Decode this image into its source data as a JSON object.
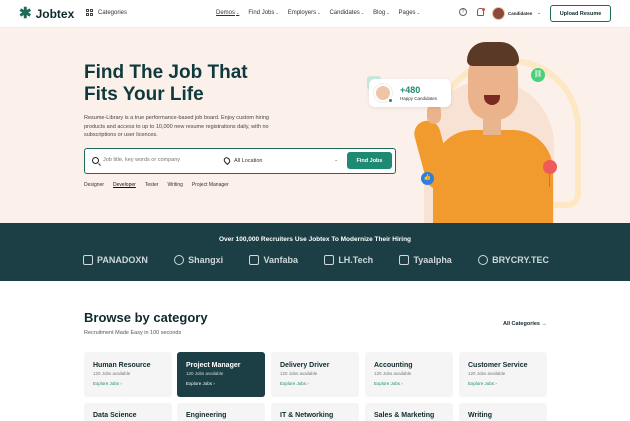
{
  "header": {
    "logo": "Jobtex",
    "categories": "Categories",
    "nav": [
      {
        "label": "Demos"
      },
      {
        "label": "Find Jobs"
      },
      {
        "label": "Employers"
      },
      {
        "label": "Candidates"
      },
      {
        "label": "Blog"
      },
      {
        "label": "Pages"
      }
    ],
    "user_label": "Candidates",
    "upload_button": "Upload Resume"
  },
  "hero": {
    "title_line1": "Find The Job That",
    "title_line2": "Fits Your Life",
    "description": "Resume-Library is a true performance-based job board. Enjoy custom hiring products and access to up to 10,000 new resume registrations daily, with no subscriptions or user licences.",
    "search_placeholder": "Job title, key words or company",
    "location": "All Location",
    "find_button": "Find Jobs",
    "tags": [
      "Designer",
      "Developer",
      "Tester",
      "Writing",
      "Project Manager"
    ],
    "happy_count": "+480",
    "happy_label": "Happy Candidates"
  },
  "recruiters": {
    "title": "Over 100,000 Recruiters Use Jobtex To Modernize Their Hiring",
    "brands": [
      "PANADOXN",
      "Shangxi",
      "Vanfaba",
      "LH.Tech",
      "Tyaalpha",
      "BRYCRY.TEC"
    ]
  },
  "browse": {
    "title": "Browse by category",
    "subtitle": "Recruitment Made Easy in 100 seconds",
    "all_categories": "All Categories",
    "cards": [
      {
        "title": "Human Resource",
        "jobs": "120 Jobs available",
        "explore": "Explore Jobs"
      },
      {
        "title": "Project Manager",
        "jobs": "120 Jobs available",
        "explore": "Explore Jobs"
      },
      {
        "title": "Delivery Driver",
        "jobs": "120 Jobs available",
        "explore": "Explore Jobs"
      },
      {
        "title": "Accounting",
        "jobs": "120 Jobs available",
        "explore": "Explore Jobs"
      },
      {
        "title": "Customer Service",
        "jobs": "120 Jobs available",
        "explore": "Explore Jobs"
      }
    ],
    "cards_row2": [
      "Data Science",
      "Engineering",
      "IT & Networking",
      "Sales & Marketing",
      "Writing"
    ]
  },
  "colors": {
    "accent": "#1e8a73",
    "dark": "#1b3f45",
    "hero_bg": "#fbf1ea"
  }
}
